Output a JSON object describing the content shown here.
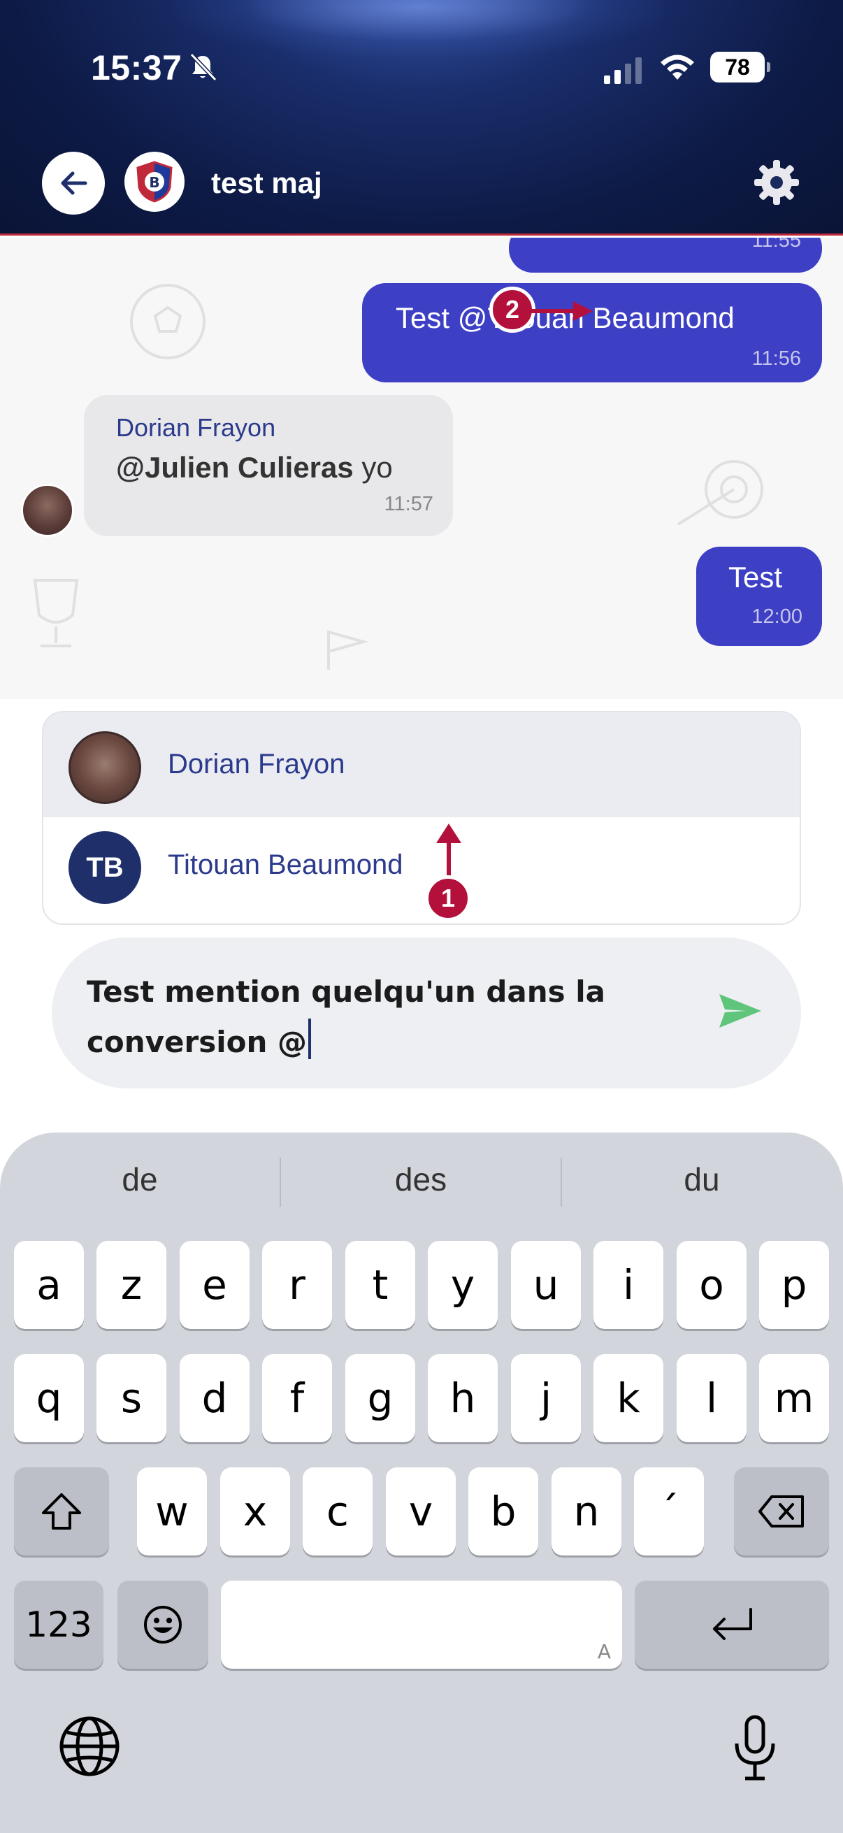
{
  "status_bar": {
    "time": "15:37",
    "battery": "78"
  },
  "header": {
    "title": "test maj"
  },
  "messages": {
    "partial_time": "11:55",
    "mention": {
      "text": "Test @Titouan Beaumond",
      "time": "11:56"
    },
    "incoming": {
      "sender": "Dorian Frayon",
      "mention": "@Julien Culieras",
      "rest": " yo",
      "time": "11:57"
    },
    "test": {
      "text": "Test",
      "time": "12:00"
    }
  },
  "annotations": {
    "one": "1",
    "two": "2"
  },
  "suggestions": [
    {
      "name": "Dorian Frayon",
      "initials": ""
    },
    {
      "name": "Titouan Beaumond",
      "initials": "TB"
    }
  ],
  "input": {
    "value": "Test mention quelqu'un dans la conversion @"
  },
  "keyboard": {
    "predictions": [
      "de",
      "des",
      "du"
    ],
    "row1": [
      "a",
      "z",
      "e",
      "r",
      "t",
      "y",
      "u",
      "i",
      "o",
      "p"
    ],
    "row2": [
      "q",
      "s",
      "d",
      "f",
      "g",
      "h",
      "j",
      "k",
      "l",
      "m"
    ],
    "row3": [
      "w",
      "x",
      "c",
      "v",
      "b",
      "n",
      "´"
    ],
    "numbers_label": "123",
    "space_hint": "A"
  },
  "colors": {
    "accent": "#3d3fc4",
    "annotation": "#b3113c",
    "send": "#5fc57a",
    "name_text": "#2b3a8c"
  }
}
